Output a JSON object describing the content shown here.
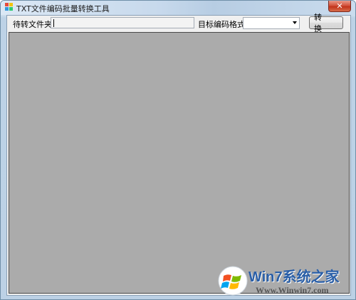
{
  "window": {
    "title": "TXT文件编码批量转换工具",
    "close_glyph": "✕"
  },
  "form": {
    "folder_label": "待转文件夹:",
    "folder_value": "",
    "format_label": "目标编码格式:",
    "format_selected": "",
    "convert_label": "转 换"
  },
  "watermark": {
    "brand": "Win7系统之家",
    "url": "Www.Winwin7.com"
  },
  "colors": {
    "panel": "#ababab",
    "client": "#f0f0f0",
    "close_button": "#c2341b"
  }
}
